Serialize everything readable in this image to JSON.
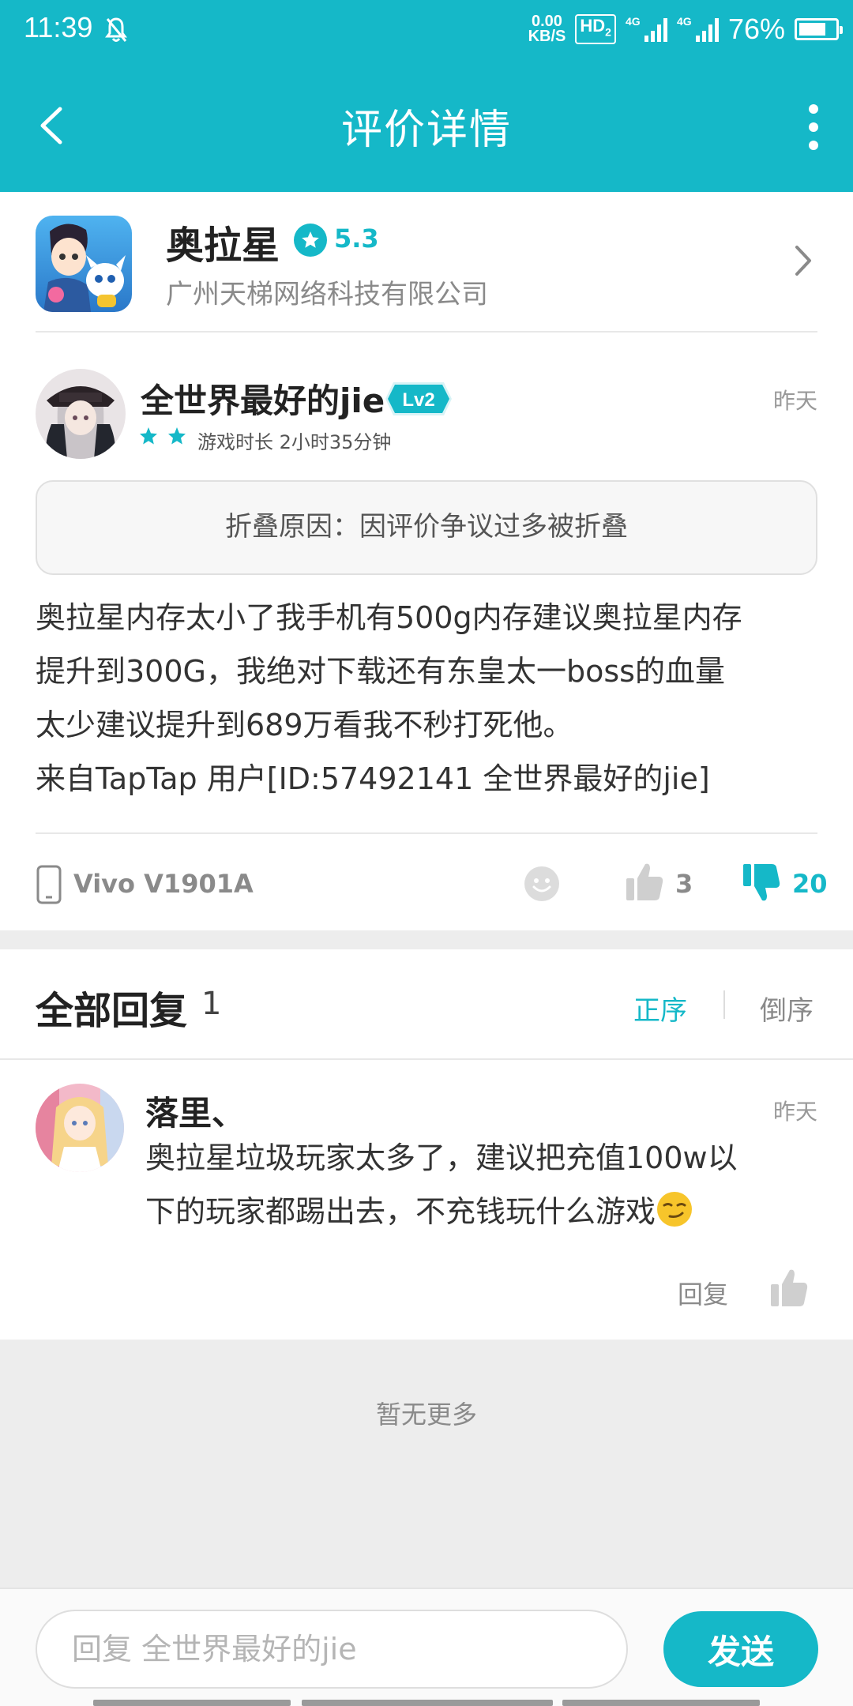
{
  "status_bar": {
    "time": "11:39",
    "net_speed": "0.00",
    "net_unit": "KB/S",
    "hd": "HD",
    "hd_sub": "2",
    "sim1": "4G",
    "sim2": "4G",
    "battery": "76%",
    "battery_level": 0.76
  },
  "header": {
    "title": "评价详情",
    "back_icon": "back-arrow-icon",
    "more_icon": "more-vertical-icon"
  },
  "app": {
    "name": "奥拉星",
    "rating": "5.3",
    "developer": "广州天梯网络科技有限公司"
  },
  "review": {
    "author": "全世界最好的jie",
    "level": "Lv2",
    "stars": 2,
    "playtime": "游戏时长 2小时35分钟",
    "time": "昨天",
    "fold_reason": "折叠原因：因评价争议过多被折叠",
    "body_lines": [
      "奥拉星内存太小了我手机有500g内存建议奥拉星内存",
      "提升到300G，我绝对下载还有东皇太一boss的血量",
      "太少建议提升到689万看我不秒打死他。",
      "来自TapTap 用户[ID:57492141 全世界最好的jie]"
    ],
    "device": "Vivo V1901A",
    "likes": "3",
    "dislikes": "20"
  },
  "replies": {
    "title": "全部回复",
    "count": "1",
    "sort_asc": "正序",
    "sort_desc": "倒序",
    "items": [
      {
        "author": "落里、",
        "time": "昨天",
        "body_line1": "奥拉星垃圾玩家太多了，建议把充值100w以",
        "body_line2": "下的玩家都踢出去，不充钱玩什么游戏",
        "reply_label": "回复"
      }
    ],
    "no_more": "暂无更多"
  },
  "composer": {
    "placeholder": "回复 全世界最好的jie",
    "send_label": "发送"
  },
  "colors": {
    "accent": "#15b8c8",
    "muted": "#8a8a8a",
    "background_gray": "#ededed"
  }
}
